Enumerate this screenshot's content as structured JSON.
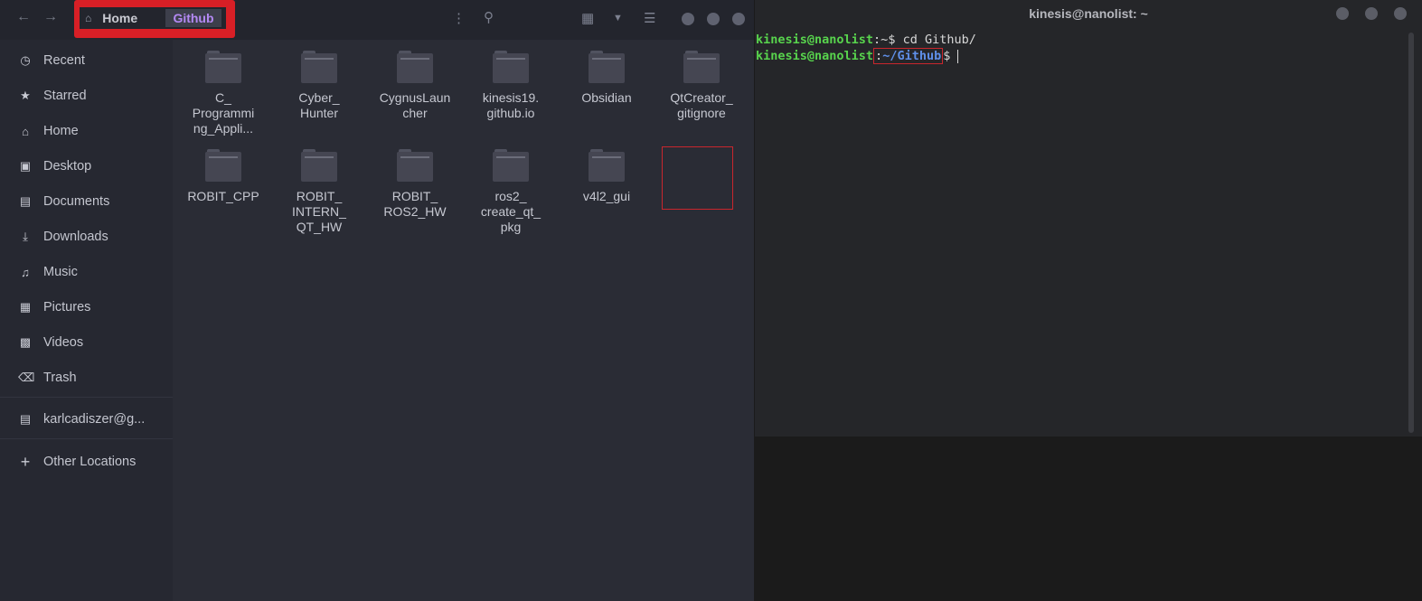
{
  "file_manager": {
    "breadcrumb": {
      "home": "Home",
      "current": "Github"
    },
    "sidebar": [
      {
        "label": "Recent",
        "icon": "clock-icon"
      },
      {
        "label": "Starred",
        "icon": "star-icon"
      },
      {
        "label": "Home",
        "icon": "home-icon"
      },
      {
        "label": "Desktop",
        "icon": "desktop-icon"
      },
      {
        "label": "Documents",
        "icon": "document-icon"
      },
      {
        "label": "Downloads",
        "icon": "download-icon"
      },
      {
        "label": "Music",
        "icon": "music-icon"
      },
      {
        "label": "Pictures",
        "icon": "picture-icon"
      },
      {
        "label": "Videos",
        "icon": "video-icon"
      },
      {
        "label": "Trash",
        "icon": "trash-icon"
      },
      {
        "label": "karlcadiszer@g...",
        "icon": "account-icon"
      },
      {
        "label": "Other Locations",
        "icon": "plus-icon"
      }
    ],
    "folders": [
      "C_\nProgrammi\nng_Appli...",
      "Cyber_\nHunter",
      "CygnusLaun\ncher",
      "kinesis19.\ngithub.io",
      "Obsidian",
      "QtCreator_\ngitignore",
      "ROBIT_CPP",
      "ROBIT_\nINTERN_\nQT_HW",
      "ROBIT_\nROS2_HW",
      "ros2_\ncreate_qt_\npkg",
      "v4l2_gui"
    ]
  },
  "terminal": {
    "title": "kinesis@nanolist: ~",
    "line1": {
      "user": "kinesis@nanolist",
      "path": ":~",
      "cmd": "$ cd Github/"
    },
    "line2": {
      "user": "kinesis@nanolist",
      "colon": ":",
      "path": "~/Github",
      "prompt": "$"
    }
  },
  "colors": {
    "highlight": "#d81f26",
    "accent": "#b489f4",
    "prompt_user": "#58d44d",
    "prompt_path": "#5f8fe8"
  }
}
